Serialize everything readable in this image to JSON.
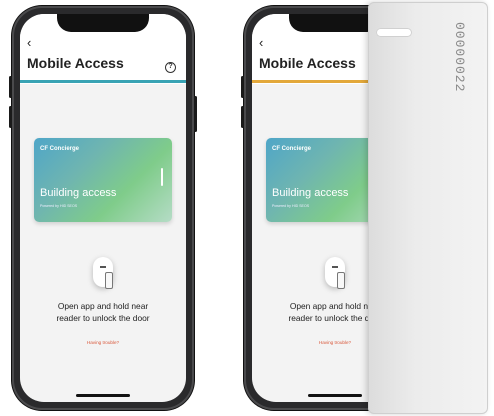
{
  "screens": [
    {
      "back_label": "‹",
      "title": "Mobile Access",
      "help_icon": "?",
      "card_brand": "CF Concierge",
      "card_name": "Building access",
      "card_sub": "Powered by HID SEOS",
      "instruction_line1": "Open app and hold near",
      "instruction_line2": "reader to unlock the door",
      "help_link": "Having trouble?"
    },
    {
      "back_label": "‹",
      "title": "Mobile Access",
      "card_brand": "CF Concierge",
      "card_name": "Building access",
      "card_sub": "Powered by HID SEOS",
      "instruction_line1": "Open app and hold near",
      "instruction_line2": "reader to unlock the door",
      "help_link": "Having trouble?"
    }
  ],
  "access_card": {
    "number": "00000022"
  },
  "colors": {
    "divider_left": "#39a3b4",
    "divider_right": "#e3a83a",
    "help_link": "#d9573a"
  }
}
